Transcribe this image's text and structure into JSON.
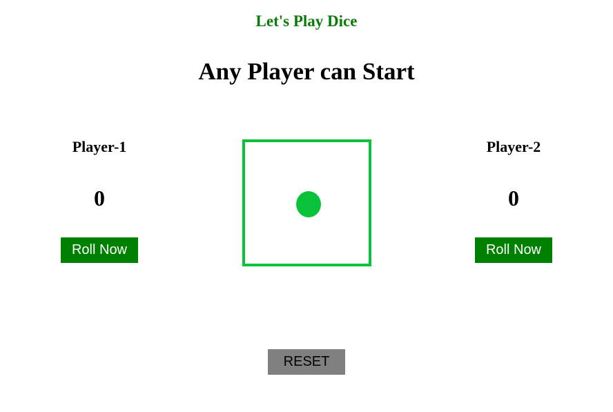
{
  "header": {
    "title": "Let's Play Dice",
    "status": "Any Player can Start"
  },
  "players": [
    {
      "name": "Player-1",
      "score": "0",
      "roll_label": "Roll Now"
    },
    {
      "name": "Player-2",
      "score": "0",
      "roll_label": "Roll Now"
    }
  ],
  "dice": {
    "value": 1,
    "color": "#0ac23a"
  },
  "controls": {
    "reset_label": "RESET"
  },
  "colors": {
    "title": "#0b7a0b",
    "roll_button": "#008000",
    "reset_button": "#808080"
  }
}
